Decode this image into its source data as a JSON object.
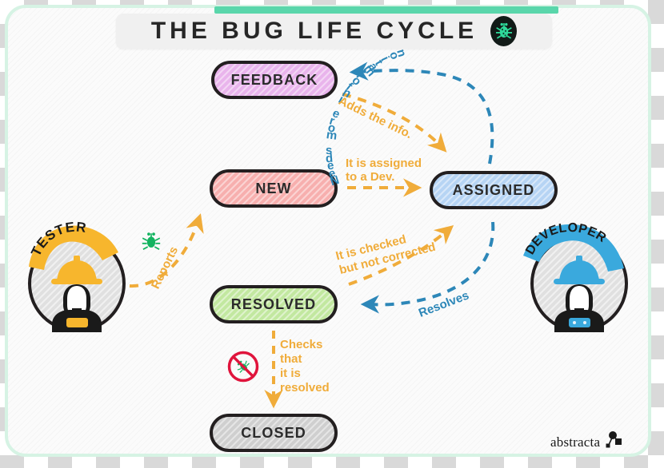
{
  "header": {
    "title": "THE BUG LIFE CYCLE",
    "bug_icon": "bug-icon",
    "accent_color": "#5ad6ab",
    "banner_bg": "#f0f0f0"
  },
  "states": [
    {
      "id": "feedback",
      "label": "FEEDBACK",
      "color": "#e9b4ec"
    },
    {
      "id": "new",
      "label": "NEW",
      "color": "#f7afae"
    },
    {
      "id": "assigned",
      "label": "ASSIGNED",
      "color": "#b6d4f4"
    },
    {
      "id": "resolved",
      "label": "RESOLVED",
      "color": "#c2e8a0"
    },
    {
      "id": "closed",
      "label": "CLOSED",
      "color": "#cfcfcf"
    }
  ],
  "transitions": [
    {
      "id": "needs-more-information",
      "label": "Needs more information",
      "from": "assigned",
      "to": "feedback",
      "color": "#2d87b8"
    },
    {
      "id": "adds-the-info",
      "label": "Adds the info.",
      "from": "feedback",
      "to": "assigned",
      "color": "#f0ac3a"
    },
    {
      "id": "assigned-to-dev",
      "label_line1": "It is assigned",
      "label_line2": "to a Dev.",
      "from": "new",
      "to": "assigned",
      "color": "#f0ac3a"
    },
    {
      "id": "checked-not-corrected",
      "label_line1": "It is checked",
      "label_line2": "but not corrected",
      "from": "resolved",
      "to": "assigned",
      "color": "#f0ac3a"
    },
    {
      "id": "resolves",
      "label": "Resolves",
      "from": "assigned",
      "to": "resolved",
      "color": "#2d87b8"
    },
    {
      "id": "reports",
      "label": "Reports",
      "from": "tester",
      "to": "new",
      "color": "#f0ac3a"
    },
    {
      "id": "checks-that-resolved",
      "label_line1": "Checks",
      "label_line2": "that",
      "label_line3": "it is",
      "label_line4": "resolved",
      "from": "resolved",
      "to": "closed",
      "color": "#f0ac3a"
    }
  ],
  "actors": [
    {
      "id": "tester",
      "label": "TESTER",
      "ribbon_color": "#f7b62d",
      "helmet_color": "#f7b62d"
    },
    {
      "id": "developer",
      "label": "DEVELOPER",
      "ribbon_color": "#3aa9dd",
      "helmet_color": "#3aa9dd"
    }
  ],
  "icons": {
    "no_bug": "no-bug-icon",
    "bug_green": "green-bug-icon"
  },
  "footer": {
    "brand": "abstracta",
    "logo_icon": "abstracta-nodes-logo"
  },
  "curved_label_chars": "Needs more information"
}
